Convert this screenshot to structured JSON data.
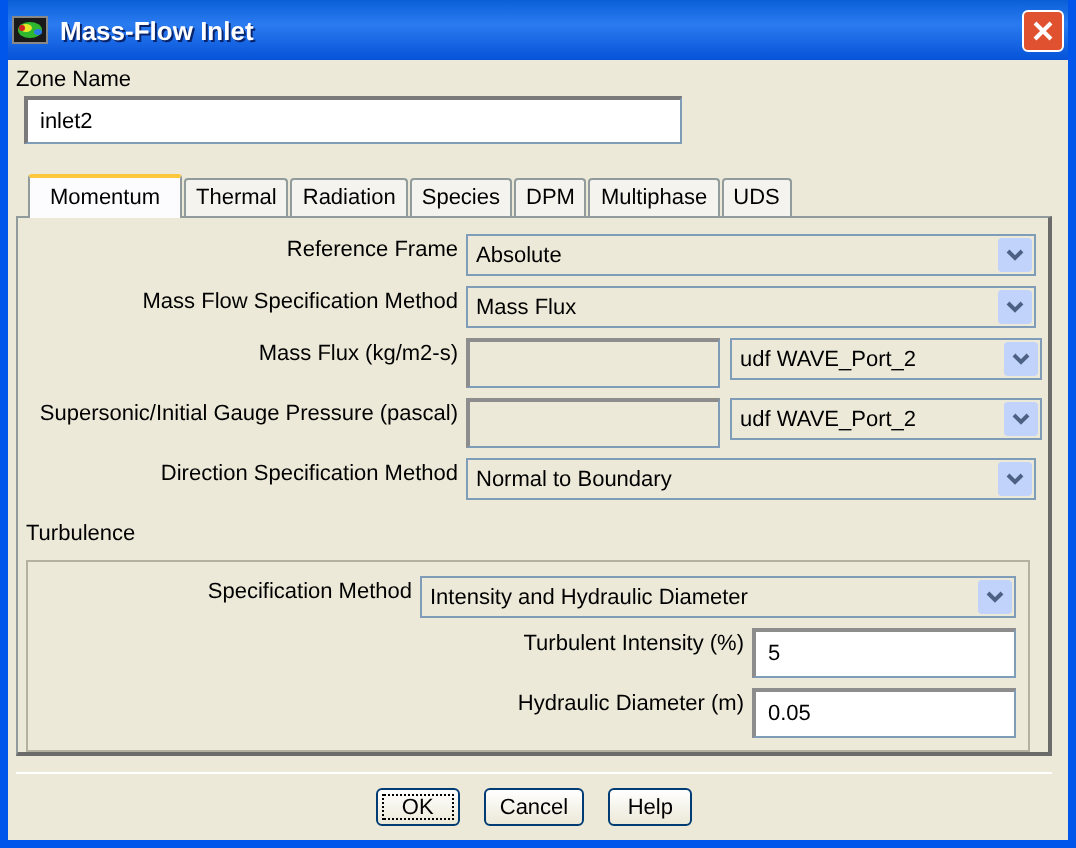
{
  "window": {
    "title": "Mass-Flow Inlet"
  },
  "zone_name": {
    "label": "Zone Name",
    "value": "inlet2"
  },
  "tabs": [
    {
      "label": "Momentum",
      "selected": true
    },
    {
      "label": "Thermal",
      "selected": false
    },
    {
      "label": "Radiation",
      "selected": false
    },
    {
      "label": "Species",
      "selected": false
    },
    {
      "label": "DPM",
      "selected": false
    },
    {
      "label": "Multiphase",
      "selected": false
    },
    {
      "label": "UDS",
      "selected": false
    }
  ],
  "fields": [
    {
      "kind": "dropdown",
      "label": "Reference Frame",
      "value": "Absolute"
    },
    {
      "kind": "dropdown",
      "label": "Mass Flow Specification Method",
      "value": "Mass Flux"
    },
    {
      "kind": "profile",
      "label": "Mass Flux (kg/m2-s)",
      "disabled": true,
      "profile": "udf WAVE_Port_2"
    },
    {
      "kind": "profile",
      "label": "Supersonic/Initial Gauge Pressure (pascal)",
      "disabled": true,
      "profile": "udf WAVE_Port_2"
    },
    {
      "kind": "dropdown",
      "label": "Direction Specification Method",
      "value": "Normal to Boundary"
    }
  ],
  "turbulence": {
    "title": "Turbulence",
    "fields": [
      {
        "kind": "dropdown",
        "label": "Specification Method",
        "value": "Intensity and Hydraulic Diameter"
      },
      {
        "kind": "text",
        "label": "Turbulent Intensity (%)",
        "value": "5"
      },
      {
        "kind": "text",
        "label": "Hydraulic Diameter (m)",
        "value": "0.05"
      }
    ]
  },
  "buttons": [
    {
      "label": "OK",
      "focused": true
    },
    {
      "label": "Cancel",
      "focused": false
    },
    {
      "label": "Help",
      "focused": false
    }
  ]
}
